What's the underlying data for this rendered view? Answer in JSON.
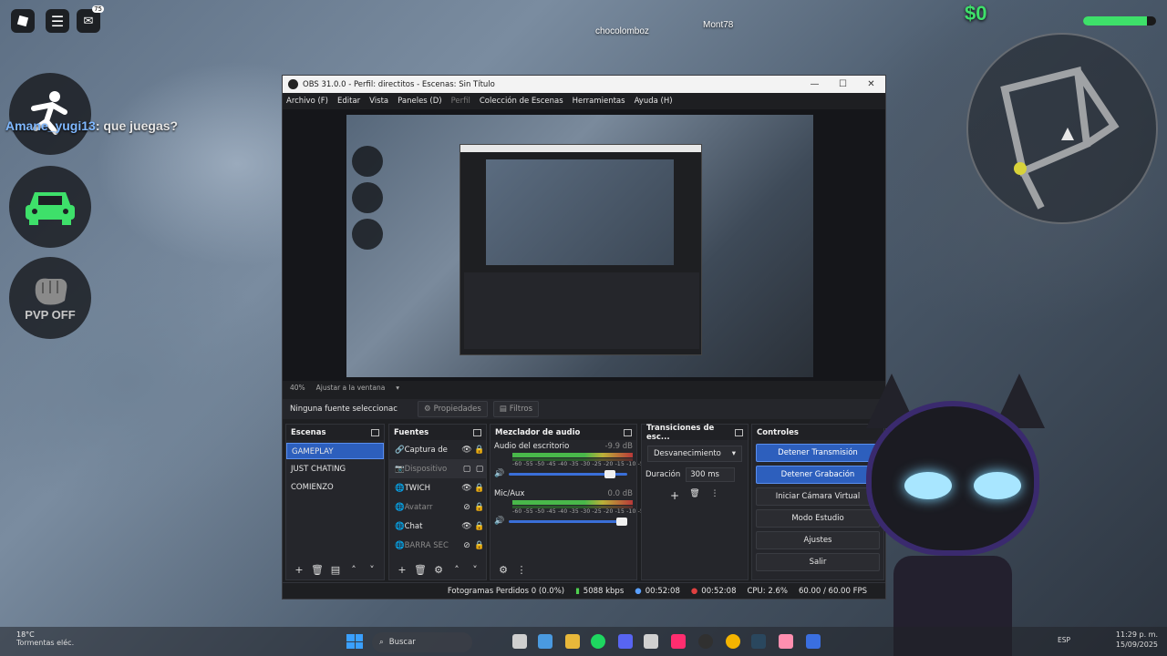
{
  "game": {
    "chat_badge": "75",
    "chat_user": "Amane_yugi13",
    "chat_message": ": que juegas?",
    "player_tags": [
      "chocolomboz",
      "Mont78"
    ],
    "money": "$0",
    "health": 0.88,
    "pvp_label": "PVP OFF",
    "colors": {
      "accent_green": "#3ee06a",
      "chat_user": "#7fb8ff"
    }
  },
  "obs": {
    "title": "OBS 31.0.0 - Perfil: directitos - Escenas: Sin Título",
    "menu": [
      "Archivo (F)",
      "Editar",
      "Vista",
      "Paneles (D)",
      "Perfil",
      "Colección de Escenas",
      "Herramientas",
      "Ayuda (H)"
    ],
    "zoom": "40%",
    "zoom_mode": "Ajustar a la ventana",
    "no_source": "Ninguna fuente seleccionac",
    "properties_btn": "Propiedades",
    "filters_btn": "Filtros",
    "docks": {
      "scenes_title": "Escenas",
      "sources_title": "Fuentes",
      "mixer_title": "Mezclador de audio",
      "transitions_title": "Transiciones de esc...",
      "controls_title": "Controles"
    },
    "scenes": [
      "GAMEPLAY",
      "JUST CHATING",
      "COMIENZO"
    ],
    "sources": [
      {
        "name": "Captura de",
        "visible": true
      },
      {
        "name": "Dispositivo",
        "visible": false
      },
      {
        "name": "TWICH",
        "visible": true
      },
      {
        "name": "Avatarr",
        "visible": false
      },
      {
        "name": "Chat",
        "visible": true
      },
      {
        "name": "BARRA SEC",
        "visible": false
      }
    ],
    "mixer": [
      {
        "name": "Audio del escritorio",
        "db": "-9.9 dB",
        "volume": 0.9
      },
      {
        "name": "Mic/Aux",
        "db": "0.0 dB",
        "volume": 1.0
      }
    ],
    "meter_ticks": "-60 -55 -50 -45 -40 -35 -30 -25 -20 -15 -10 -5 0",
    "transition": {
      "type": "Desvanecimiento",
      "duration_label": "Duración",
      "duration_value": "300 ms"
    },
    "controls": [
      {
        "label": "Detener Transmisión",
        "active": true
      },
      {
        "label": "Detener Grabación",
        "active": true
      },
      {
        "label": "Iniciar Cámara Virtual",
        "active": false
      },
      {
        "label": "Modo Estudio",
        "active": false
      },
      {
        "label": "Ajustes",
        "active": false
      },
      {
        "label": "Salir",
        "active": false
      }
    ],
    "status": {
      "dropped": "Fotogramas Perdidos 0 (0.0%)",
      "bitrate": "5088 kbps",
      "stream_time": "00:52:08",
      "rec_time": "00:52:08",
      "cpu": "CPU: 2.6%",
      "fps": "60.00 / 60.00 FPS"
    }
  },
  "taskbar": {
    "temp": "18°C",
    "weather": "Tormentas eléc.",
    "search": "Buscar",
    "lang": "ESP",
    "time": "11:29 p. m.",
    "date": "15/09/2025"
  }
}
